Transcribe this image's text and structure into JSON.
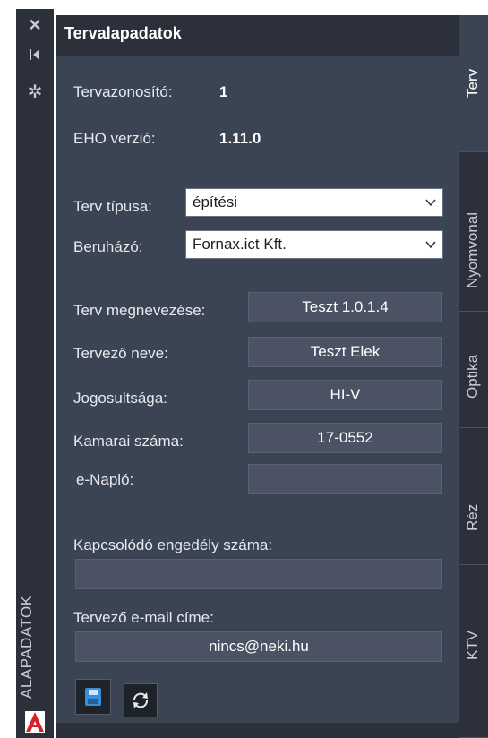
{
  "left_strip": {
    "vertical_title": "ALAPADATOK",
    "icons": [
      "close-icon",
      "collapse-icon",
      "gear-icon",
      "autocad-logo"
    ]
  },
  "panel": {
    "title": "Tervalapadatok",
    "info": {
      "plan_id_label": "Tervazonosító:",
      "plan_id_value": "1",
      "eho_version_label": "EHO verzió:",
      "eho_version_value": "1.11.0"
    },
    "plan_type": {
      "label": "Terv típusa:",
      "value": "építési"
    },
    "investor": {
      "label": "Beruházó:",
      "value": "Fornax.ict Kft."
    },
    "fields": {
      "plan_name": {
        "label": "Terv megnevezése:",
        "value": "Teszt 1.0.1.4"
      },
      "designer_name": {
        "label": "Tervező neve:",
        "value": "Teszt Elek"
      },
      "authorization": {
        "label": "Jogosultsága:",
        "value": "HI-V"
      },
      "chamber_number": {
        "label": "Kamarai száma:",
        "value": "17-0552"
      },
      "e_naplo": {
        "label": "e-Napló:",
        "value": ""
      }
    },
    "permit_number": {
      "label": "Kapcsolódó engedély száma:",
      "value": ""
    },
    "designer_email": {
      "label": "Tervező e-mail címe:",
      "value": "nincs@neki.hu"
    },
    "buttons": [
      "save-icon",
      "refresh-icon"
    ]
  },
  "tabs": [
    {
      "label": "Terv",
      "active": true
    },
    {
      "label": "Nyomvonal",
      "active": false
    },
    {
      "label": "Optika",
      "active": false
    },
    {
      "label": "Réz",
      "active": false
    },
    {
      "label": "KTV",
      "active": false
    }
  ],
  "colors": {
    "panel_bg": "#3b4453",
    "header_bg": "#2b303b",
    "field_bg": "#4a5263",
    "save_blue": "#3a8fd8",
    "autocad_red": "#d8232a"
  }
}
